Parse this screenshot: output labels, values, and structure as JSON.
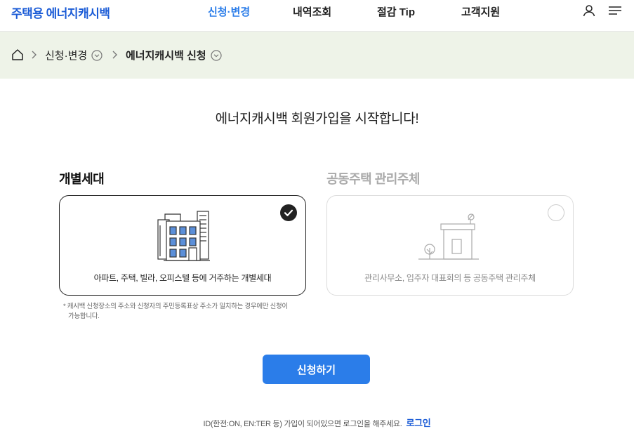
{
  "header": {
    "logo": "주택용 에너지캐시백",
    "nav": [
      {
        "label": "신청·변경",
        "active": true
      },
      {
        "label": "내역조회",
        "active": false
      },
      {
        "label": "절감 Tip",
        "active": false
      },
      {
        "label": "고객지원",
        "active": false
      }
    ],
    "icons": [
      "user-icon",
      "menu-icon"
    ]
  },
  "breadcrumb": {
    "home_icon": "home-icon",
    "items": [
      {
        "label": "신청·변경"
      },
      {
        "label": "에너지캐시백 신청"
      }
    ]
  },
  "main": {
    "heading": "에너지캐시백 회원가입을 시작합니다!",
    "options": [
      {
        "title": "개별세대",
        "caption": "아파트, 주택, 빌라, 오피스텔 등에 거주하는 개별세대",
        "selected": true,
        "icon": "apartment-building-icon"
      },
      {
        "title": "공동주택 관리주체",
        "caption": "관리사무소, 입주자 대표회의 등 공동주택 관리주체",
        "selected": false,
        "icon": "management-office-icon"
      }
    ],
    "note_line1": "* 캐시백 신청장소의 주소와 신청자의 주민등록표상 주소가 일치하는 경우에만 신청이",
    "note_line2": "가능합니다.",
    "submit_label": "신청하기"
  },
  "footer": {
    "text": "ID(한전:ON, EN:TER 등) 가입이 되어있으면 로그인을 해주세요.",
    "login_label": "로그인"
  },
  "colors": {
    "accent": "#2b7de9",
    "logo": "#1a5bd6",
    "breadcrumb_bg": "#eef3e8",
    "building_window": "#5b8fd9"
  }
}
